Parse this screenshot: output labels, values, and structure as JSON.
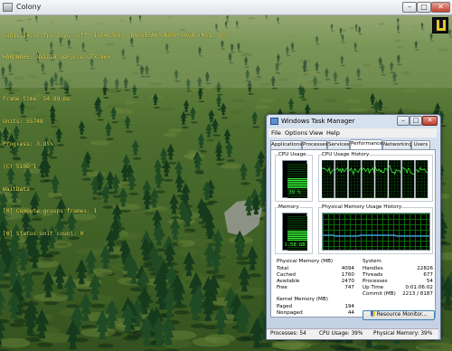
{
  "colony": {
    "title": "Colony",
    "caption_min": "–",
    "caption_max": "□",
    "caption_close": "✕",
    "hud_lines": [
      "D3D11 14.95 fps Vsync off (1024x768), R8G8B8A8_UNORM_SRGB (MS1, Q0)",
      "HARDWARE: NVIDIA GeForce GTX 460"
    ],
    "hud_stats": [
      "Frame time: 54.99 ms",
      "Units: 55748",
      "Progress: 3.85%",
      "(C) 510D 1",
      "WaitData",
      "[0] Compute groups frames: 1",
      "[0] Status unit count: 0"
    ]
  },
  "task_manager": {
    "title": "Windows Task Manager",
    "caption_min": "–",
    "caption_max": "□",
    "caption_close": "✕",
    "menu": [
      "File",
      "Options",
      "View",
      "Help"
    ],
    "tabs": [
      "Applications",
      "Processes",
      "Services",
      "Performance",
      "Networking",
      "Users"
    ],
    "active_tab": "Performance",
    "cpu_usage_label": "CPU Usage",
    "cpu_usage_value": "39 %",
    "cpu_usage_percent": 39,
    "cpu_history_label": "CPU Usage History",
    "memory_label": "Memory",
    "memory_value": "1.58 GB",
    "memory_fraction": 0.39,
    "pm_history_label": "Physical Memory Usage History",
    "physical_memory": {
      "heading": "Physical Memory (MB)",
      "rows": [
        {
          "k": "Total",
          "v": "4094"
        },
        {
          "k": "Cached",
          "v": "1760"
        },
        {
          "k": "Available",
          "v": "2470"
        },
        {
          "k": "Free",
          "v": "747"
        }
      ]
    },
    "kernel_memory": {
      "heading": "Kernel Memory (MB)",
      "rows": [
        {
          "k": "Paged",
          "v": "194"
        },
        {
          "k": "Nonpaged",
          "v": "44"
        }
      ]
    },
    "system": {
      "heading": "System",
      "rows": [
        {
          "k": "Handles",
          "v": "22826"
        },
        {
          "k": "Threads",
          "v": "677"
        },
        {
          "k": "Processes",
          "v": "54"
        },
        {
          "k": "Up Time",
          "v": "0:01:06:02"
        },
        {
          "k": "Commit (MB)",
          "v": "2213 / 8187"
        }
      ]
    },
    "resource_monitor_label": "Resource Monitor...",
    "status": {
      "processes": "Processes: 54",
      "cpu": "CPU Usage: 39%",
      "memory": "Physical Memory: 39%"
    }
  },
  "colors": {
    "hud_text": "#e8e05a",
    "graph_green": "#3cf23c",
    "memory_line": "#4aa3ff"
  }
}
